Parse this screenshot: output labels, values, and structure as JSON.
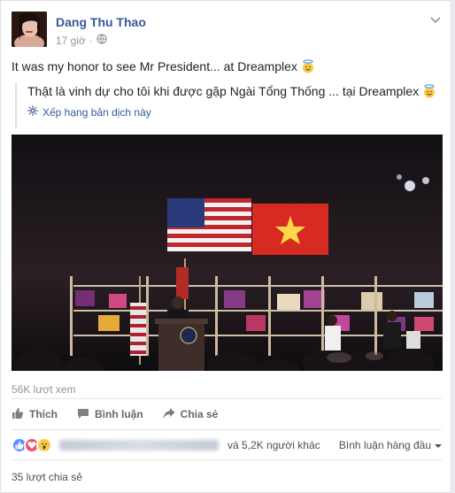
{
  "post": {
    "author": "Dang Thu Thao",
    "time": "17 giờ",
    "text": "It was my honor to see Mr President... at Dreamplex",
    "translation": "Thật là vinh dự cho tôi khi được gặp Ngài Tổng Thống ... tại Dreamplex",
    "rate_translation": "Xếp hạng bản dịch này"
  },
  "video": {
    "views": "56K lượt xem"
  },
  "actions": {
    "like": "Thích",
    "comment": "Bình luận",
    "share": "Chia sẻ"
  },
  "reactions": {
    "others": "và 5,2K người khác",
    "top_comments": "Bình luận hàng đầu"
  },
  "shares": "35 lượt chia sẻ",
  "colors": {
    "link": "#365899",
    "meta": "#90949c",
    "like_blue": "#5890ff",
    "love_red": "#f25268",
    "wow_yellow": "#fcca4a"
  },
  "icons": [
    "globe-icon",
    "chevron-down-icon",
    "halo-smiley-icon",
    "gear-icon",
    "thumbs-up-icon",
    "comment-icon",
    "share-arrow-icon",
    "like-reaction-icon",
    "love-reaction-icon",
    "wow-reaction-icon",
    "caret-down-icon"
  ]
}
